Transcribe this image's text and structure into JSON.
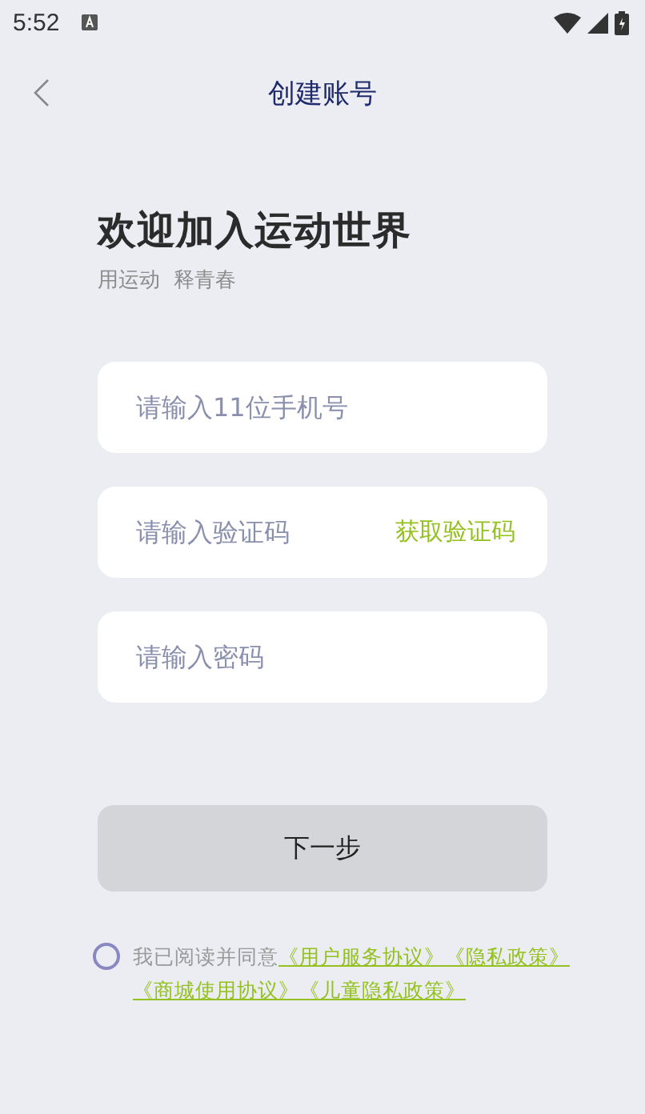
{
  "status_bar": {
    "time": "5:52"
  },
  "header": {
    "title": "创建账号"
  },
  "welcome": {
    "title": "欢迎加入运动世界",
    "subtitle": "用运动  释青春"
  },
  "fields": [
    {
      "placeholder": "请输入11位手机号"
    },
    {
      "placeholder": "请输入验证码",
      "action": "获取验证码"
    },
    {
      "placeholder": "请输入密码"
    }
  ],
  "next_button": {
    "label": "下一步",
    "disabled": true
  },
  "agreement": {
    "checked": false,
    "intro": "我已阅读并同意",
    "links": [
      "《用户服务协议》",
      "《隐私政策》",
      "《商城使用协议》",
      "《儿童隐私政策》"
    ]
  }
}
